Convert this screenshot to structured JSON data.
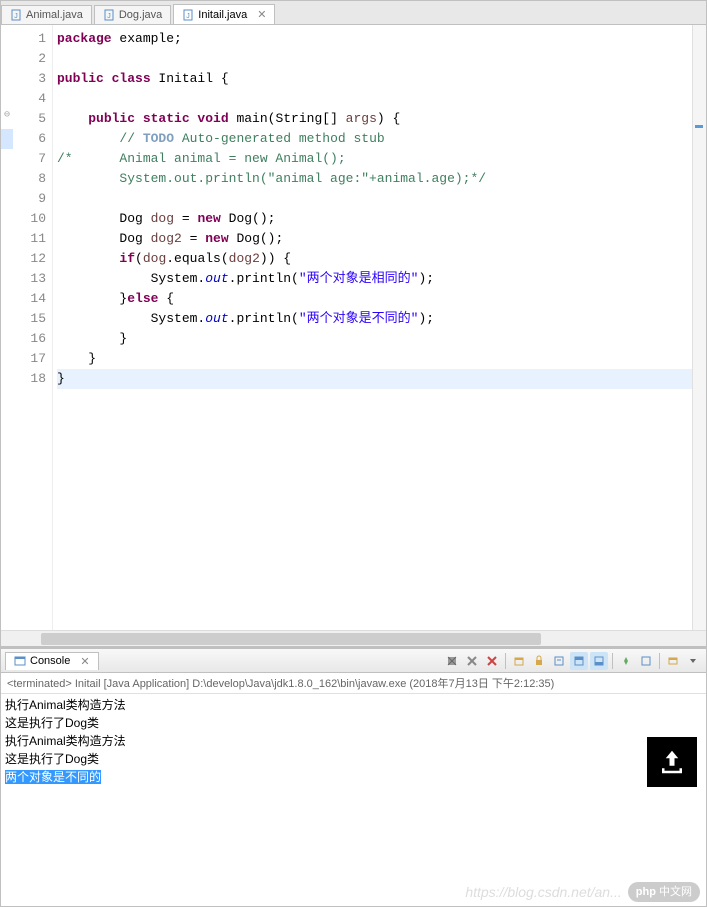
{
  "tabs": [
    {
      "label": "Animal.java",
      "active": false
    },
    {
      "label": "Dog.java",
      "active": false
    },
    {
      "label": "Initail.java",
      "active": true
    }
  ],
  "code": {
    "lines": [
      {
        "n": "1",
        "tokens": [
          {
            "t": "package ",
            "c": "kw"
          },
          {
            "t": "example;",
            "c": ""
          }
        ]
      },
      {
        "n": "2",
        "tokens": []
      },
      {
        "n": "3",
        "tokens": [
          {
            "t": "public class ",
            "c": "kw"
          },
          {
            "t": "Initail ",
            "c": "typ"
          },
          {
            "t": "{",
            "c": ""
          }
        ]
      },
      {
        "n": "4",
        "tokens": []
      },
      {
        "n": "5",
        "tokens": [
          {
            "t": "    ",
            "c": ""
          },
          {
            "t": "public static void ",
            "c": "kw"
          },
          {
            "t": "main(String[] ",
            "c": ""
          },
          {
            "t": "args",
            "c": "par"
          },
          {
            "t": ") {",
            "c": ""
          }
        ]
      },
      {
        "n": "6",
        "tokens": [
          {
            "t": "        ",
            "c": ""
          },
          {
            "t": "// ",
            "c": "cm"
          },
          {
            "t": "TODO",
            "c": "todo"
          },
          {
            "t": " Auto-generated method stub",
            "c": "cm"
          }
        ]
      },
      {
        "n": "7",
        "tokens": [
          {
            "t": "/*      Animal animal = new Animal();",
            "c": "cm"
          }
        ]
      },
      {
        "n": "8",
        "tokens": [
          {
            "t": "        System.out.println(\"animal age:\"+animal.age);*/",
            "c": "cm"
          }
        ]
      },
      {
        "n": "9",
        "tokens": []
      },
      {
        "n": "10",
        "tokens": [
          {
            "t": "        Dog ",
            "c": ""
          },
          {
            "t": "dog",
            "c": "par"
          },
          {
            "t": " = ",
            "c": ""
          },
          {
            "t": "new ",
            "c": "kw"
          },
          {
            "t": "Dog();",
            "c": ""
          }
        ]
      },
      {
        "n": "11",
        "tokens": [
          {
            "t": "        Dog ",
            "c": ""
          },
          {
            "t": "dog2",
            "c": "par"
          },
          {
            "t": " = ",
            "c": ""
          },
          {
            "t": "new ",
            "c": "kw"
          },
          {
            "t": "Dog();",
            "c": ""
          }
        ]
      },
      {
        "n": "12",
        "tokens": [
          {
            "t": "        ",
            "c": ""
          },
          {
            "t": "if",
            "c": "kw"
          },
          {
            "t": "(",
            "c": ""
          },
          {
            "t": "dog",
            "c": "par"
          },
          {
            "t": ".equals(",
            "c": ""
          },
          {
            "t": "dog2",
            "c": "par"
          },
          {
            "t": ")) {",
            "c": ""
          }
        ]
      },
      {
        "n": "13",
        "tokens": [
          {
            "t": "            System.",
            "c": ""
          },
          {
            "t": "out",
            "c": "fld"
          },
          {
            "t": ".println(",
            "c": ""
          },
          {
            "t": "\"两个对象是相同的\"",
            "c": "str"
          },
          {
            "t": ");",
            "c": ""
          }
        ]
      },
      {
        "n": "14",
        "tokens": [
          {
            "t": "        }",
            "c": ""
          },
          {
            "t": "else ",
            "c": "kw"
          },
          {
            "t": "{",
            "c": ""
          }
        ]
      },
      {
        "n": "15",
        "tokens": [
          {
            "t": "            System.",
            "c": ""
          },
          {
            "t": "out",
            "c": "fld"
          },
          {
            "t": ".println(",
            "c": ""
          },
          {
            "t": "\"两个对象是不同的\"",
            "c": "str"
          },
          {
            "t": ");",
            "c": ""
          }
        ]
      },
      {
        "n": "16",
        "tokens": [
          {
            "t": "        }",
            "c": ""
          }
        ]
      },
      {
        "n": "17",
        "tokens": [
          {
            "t": "    }",
            "c": ""
          }
        ]
      },
      {
        "n": "18",
        "tokens": [
          {
            "t": "}",
            "c": ""
          }
        ],
        "current": true
      }
    ],
    "annotations": {
      "fold": [
        5
      ],
      "warn": [
        6
      ]
    }
  },
  "console": {
    "title": "Console",
    "status": "<terminated> Initail [Java Application] D:\\develop\\Java\\jdk1.8.0_162\\bin\\javaw.exe (2018年7月13日 下午2:12:35)",
    "output": [
      {
        "text": "执行Animal类构造方法",
        "hl": false
      },
      {
        "text": "这是执行了Dog类",
        "hl": false
      },
      {
        "text": "执行Animal类构造方法",
        "hl": false
      },
      {
        "text": "这是执行了Dog类",
        "hl": false
      },
      {
        "text": "两个对象是不同的",
        "hl": true
      }
    ]
  },
  "watermark": {
    "url": "https://blog.csdn.net/an...",
    "badge1": "php",
    "badge2": "中文网"
  }
}
